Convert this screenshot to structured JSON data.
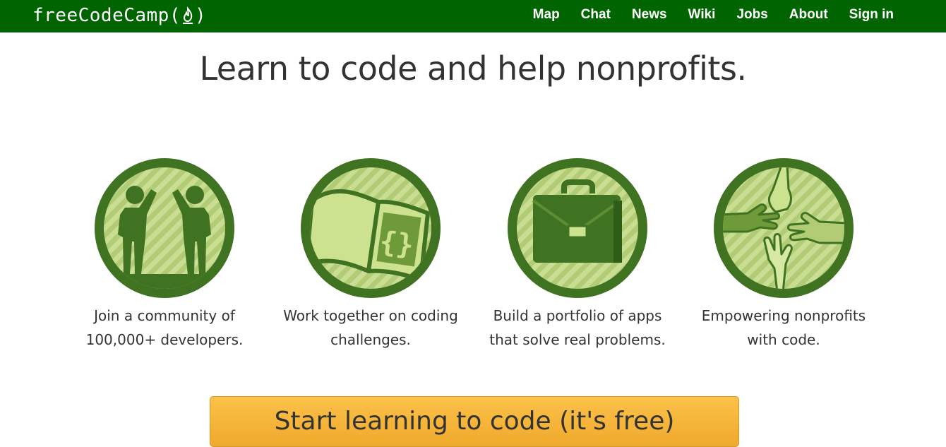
{
  "brand": {
    "name_left": "freeCodeCamp(",
    "name_right": ")"
  },
  "nav": {
    "items": [
      {
        "label": "Map"
      },
      {
        "label": "Chat"
      },
      {
        "label": "News"
      },
      {
        "label": "Wiki"
      },
      {
        "label": "Jobs"
      },
      {
        "label": "About"
      },
      {
        "label": "Sign in"
      }
    ]
  },
  "headline": "Learn to code and help nonprofits.",
  "features": [
    {
      "icon": "high-five-icon",
      "line1": "Join a community of",
      "line2": "100,000+ developers."
    },
    {
      "icon": "code-book-icon",
      "line1": "Work together on coding",
      "line2": "challenges."
    },
    {
      "icon": "briefcase-icon",
      "line1": "Build a portfolio of apps",
      "line2": "that solve real problems."
    },
    {
      "icon": "helping-hands-icon",
      "line1": "Empowering nonprofits",
      "line2": "with code."
    }
  ],
  "cta_label": "Start learning to code (it's free)",
  "colors": {
    "nav_bg": "#006400",
    "badge_dark": "#3f7321",
    "badge_light": "#c7dc8f",
    "cta": "#f7b738"
  }
}
